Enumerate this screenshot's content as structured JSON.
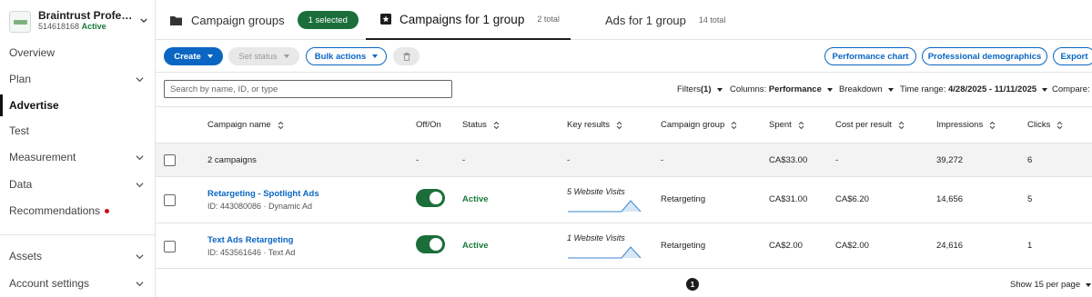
{
  "account": {
    "name": "Braintrust Professi...",
    "id": "514618168",
    "status": "Active"
  },
  "nav": {
    "overview": "Overview",
    "plan": "Plan",
    "advertise": "Advertise",
    "test": "Test",
    "measurement": "Measurement",
    "data": "Data",
    "recommendations": "Recommendations",
    "assets": "Assets",
    "account_settings": "Account settings"
  },
  "tabs": {
    "campaign_groups": "Campaign groups",
    "selected_badge": "1 selected",
    "campaigns": "Campaigns for 1 group",
    "campaigns_count": "2 total",
    "ads": "Ads for 1 group",
    "ads_count": "14 total"
  },
  "toolbar": {
    "create": "Create",
    "set_status": "Set status",
    "bulk_actions": "Bulk actions",
    "performance_chart": "Performance chart",
    "professional_demographics": "Professional demographics",
    "export": "Export"
  },
  "search": {
    "placeholder": "Search by name, ID, or type"
  },
  "filters": {
    "filters_label": "Filters",
    "filters_count": "(1)",
    "columns_label": "Columns:",
    "columns_value": "Performance",
    "breakdown": "Breakdown",
    "time_range_label": "Time range:",
    "time_range_value": "4/28/2025 - 11/11/2025",
    "compare": "Compare:"
  },
  "table": {
    "headers": {
      "campaign_name": "Campaign name",
      "off_on": "Off/On",
      "status": "Status",
      "key_results": "Key results",
      "campaign_group": "Campaign group",
      "spent": "Spent",
      "cost_per_result": "Cost per result",
      "impressions": "Impressions",
      "clicks": "Clicks"
    },
    "summary": {
      "name": "2 campaigns",
      "off_on": "-",
      "status": "-",
      "key_results": "-",
      "campaign_group": "-",
      "spent": "CA$33.00",
      "cost_per_result": "-",
      "impressions": "39,272",
      "clicks": "6"
    },
    "rows": [
      {
        "name": "Retargeting - Spotlight Ads",
        "meta": "ID: 443080086 · Dynamic Ad",
        "toggle_on": true,
        "status": "Active",
        "key_results": "5 Website Visits",
        "campaign_group": "Retargeting",
        "spent": "CA$31.00",
        "cost_per_result": "CA$6.20",
        "impressions": "14,656",
        "clicks": "5"
      },
      {
        "name": "Text Ads Retargeting",
        "meta": "ID: 453561646 · Text Ad",
        "toggle_on": true,
        "status": "Active",
        "key_results": "1 Website Visits",
        "campaign_group": "Retargeting",
        "spent": "CA$2.00",
        "cost_per_result": "CA$2.00",
        "impressions": "24,616",
        "clicks": "1"
      }
    ]
  },
  "footer": {
    "page": "1",
    "per_page": "Show 15 per page"
  },
  "colors": {
    "brand_blue": "#0a66c2",
    "active_green": "#1b6e3a",
    "notification_red": "#cc1016"
  }
}
